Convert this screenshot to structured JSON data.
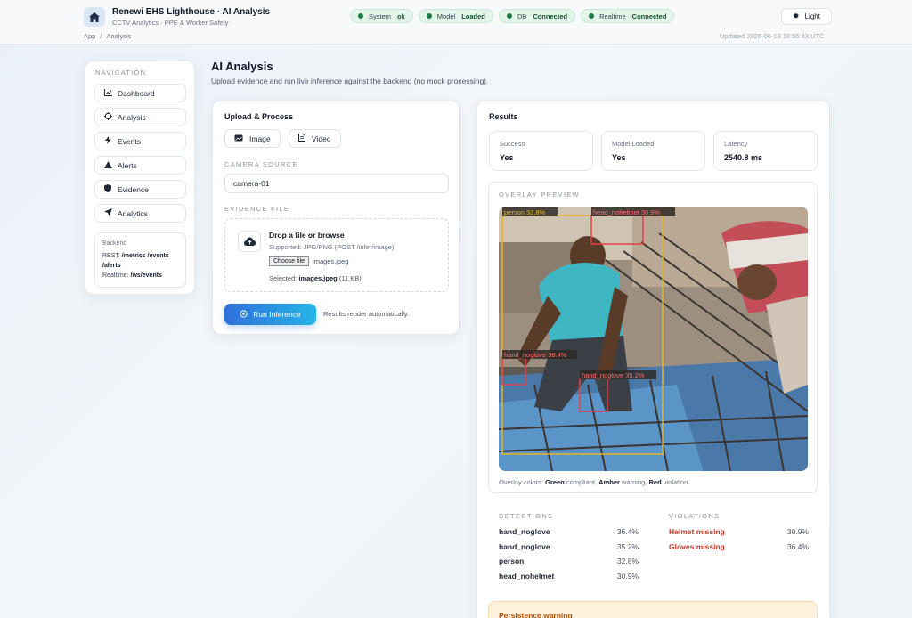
{
  "header": {
    "title": "Renewi EHS Lighthouse · AI Analysis",
    "subtitle": "CCTV Analytics · PPE & Worker Safety",
    "breadcrumb": [
      "App",
      "Analysis"
    ],
    "updated": "Updated 2026-06-13 18:55:43 UTC",
    "theme_label": "Light",
    "status_pills": [
      {
        "label": "System",
        "value": "ok"
      },
      {
        "label": "Model",
        "value": "Loaded"
      },
      {
        "label": "DB",
        "value": "Connected"
      },
      {
        "label": "Realtime",
        "value": "Connected"
      }
    ]
  },
  "sidebar": {
    "title": "NAVIGATION",
    "items": [
      {
        "label": "Dashboard",
        "icon": "chart-icon"
      },
      {
        "label": "Analysis",
        "icon": "target-icon"
      },
      {
        "label": "Events",
        "icon": "bolt-icon"
      },
      {
        "label": "Alerts",
        "icon": "warning-icon"
      },
      {
        "label": "Evidence",
        "icon": "shield-icon"
      },
      {
        "label": "Analytics",
        "icon": "send-icon"
      }
    ],
    "backend": {
      "title": "Backend",
      "rest_label": "REST:",
      "rest_value": "/metrics /events /alerts",
      "realtime_label": "Realtime:",
      "realtime_value": "/ws/events"
    }
  },
  "page": {
    "title": "AI Analysis",
    "subtitle": "Upload evidence and run live inference against the backend (no mock processing)."
  },
  "upload": {
    "title": "Upload & Process",
    "mode_image": "Image",
    "mode_video": "Video",
    "camera_label": "CAMERA SOURCE",
    "camera_value": "camera-01",
    "evidence_label": "EVIDENCE FILE",
    "drop_title": "Drop a file or browse",
    "drop_supported": "Supported: JPG/PNG (POST /infer/image)",
    "choose_file": "Choose file",
    "file_name": "images.jpeg",
    "selected_prefix": "Selected:",
    "selected_file": "images.jpeg",
    "selected_size": "(11 KB)",
    "run_label": "Run Inference",
    "run_hint": "Results render automatically."
  },
  "results": {
    "title": "Results",
    "stats": [
      {
        "label": "Success",
        "value": "Yes"
      },
      {
        "label": "Model Loaded",
        "value": "Yes"
      },
      {
        "label": "Latency",
        "value": "2540.8 ms"
      }
    ],
    "overlay_label": "OVERLAY PREVIEW",
    "boxes": [
      {
        "label": "person 32.8%",
        "color": "#e6b422"
      },
      {
        "label": "head_nohelmet 30.9%",
        "color": "#e0424b"
      },
      {
        "label": "hand_noglove 36.4%",
        "color": "#e0424b"
      },
      {
        "label": "hand_noglove 35.2%",
        "color": "#e0424b"
      }
    ],
    "legend_prefix": "Overlay colors:",
    "legend_green": "Green",
    "legend_green_text": "compliant,",
    "legend_amber": "Amber",
    "legend_amber_text": "warning,",
    "legend_red": "Red",
    "legend_red_text": "violation.",
    "detections_label": "DETECTIONS",
    "detections": [
      {
        "name": "hand_noglove",
        "value": "36.4%"
      },
      {
        "name": "hand_noglove",
        "value": "35.2%"
      },
      {
        "name": "person",
        "value": "32.8%"
      },
      {
        "name": "head_nohelmet",
        "value": "30.9%"
      }
    ],
    "violations_label": "VIOLATIONS",
    "violations": [
      {
        "name": "Helmet missing",
        "value": "30.9%"
      },
      {
        "name": "Gloves missing",
        "value": "36.4%"
      }
    ],
    "warning": "Persistence warning"
  },
  "colors": {
    "accent": "#2f6fd8",
    "ok_green": "#1f7a4a",
    "violation_red": "#c0392b",
    "warning_amber": "#b45309"
  }
}
